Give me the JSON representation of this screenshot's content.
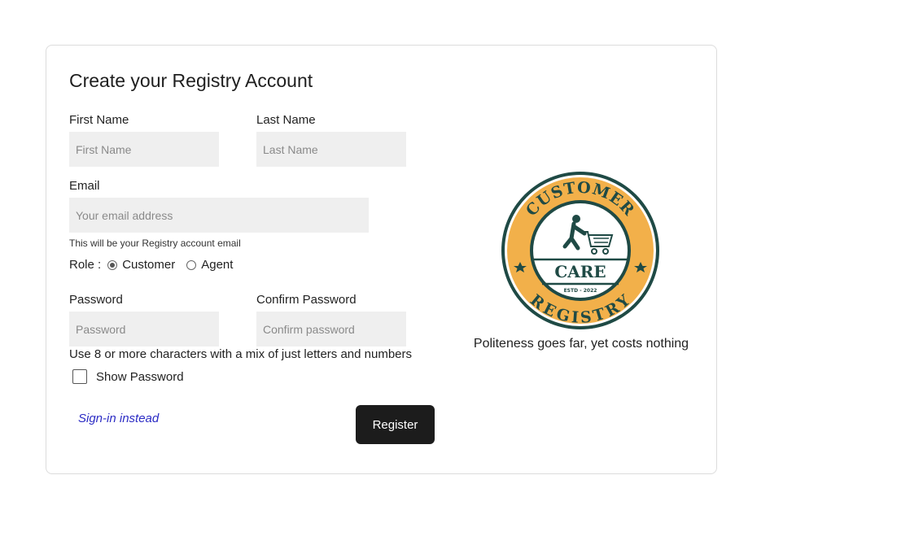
{
  "form": {
    "title": "Create your Registry Account",
    "first_name": {
      "label": "First Name",
      "placeholder": "First Name",
      "value": ""
    },
    "last_name": {
      "label": "Last Name",
      "placeholder": "Last Name",
      "value": ""
    },
    "email": {
      "label": "Email",
      "placeholder": "Your email address",
      "value": "",
      "hint": "This will be your Registry account email"
    },
    "role": {
      "label": "Role :",
      "options": [
        {
          "label": "Customer",
          "selected": true
        },
        {
          "label": "Agent",
          "selected": false
        }
      ]
    },
    "password": {
      "label": "Password",
      "placeholder": "Password",
      "value": ""
    },
    "confirm_password": {
      "label": "Confirm Password",
      "placeholder": "Confirm password",
      "value": ""
    },
    "password_hint": "Use 8 or more characters with a mix of just letters and numbers",
    "show_password": {
      "label": "Show Password",
      "checked": false
    },
    "signin_link": "Sign-in instead",
    "register_button": "Register"
  },
  "brand": {
    "logo_text_top": "CUSTOMER",
    "logo_text_middle": "CARE",
    "logo_text_estd": "ESTD - 2022",
    "logo_text_bottom": "REGISTRY",
    "logo_icon": "shopper-with-cart-icon",
    "tagline": "Politeness goes far, yet costs nothing",
    "colors": {
      "ring": "#F2B04A",
      "dark": "#1F4A45",
      "button": "#1C1C1C",
      "link": "#2B2BC4"
    }
  }
}
